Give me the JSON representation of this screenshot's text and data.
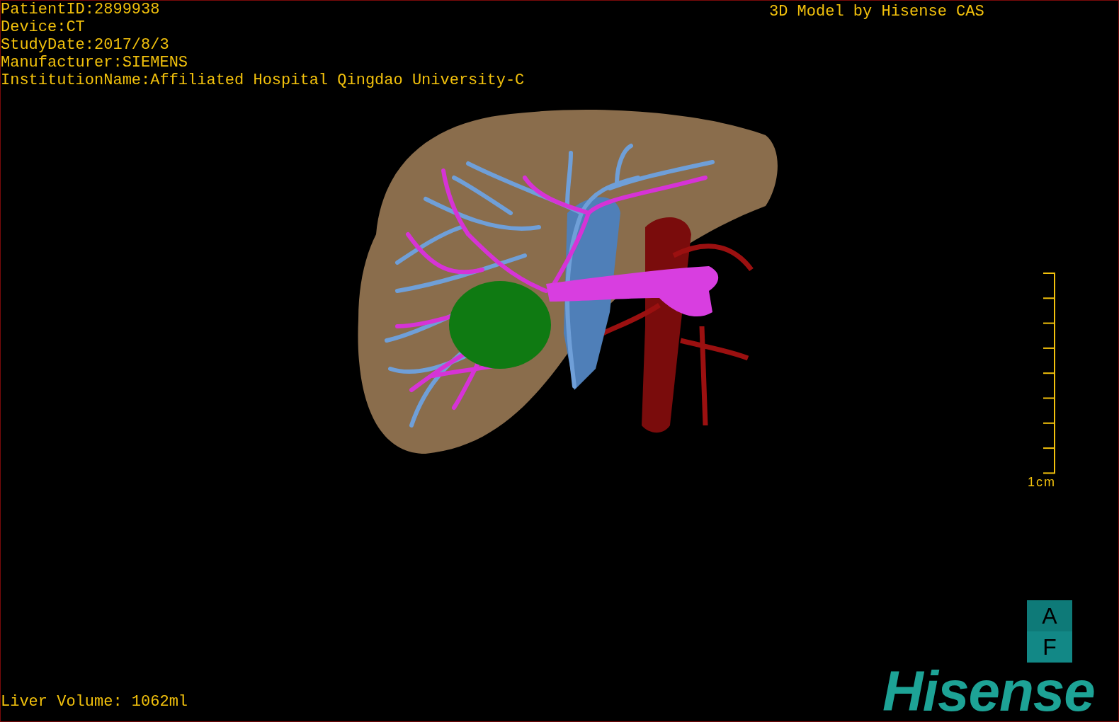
{
  "patient_info": [
    "PatientID:2899938",
    "Device:CT",
    "StudyDate:2017/8/3",
    "Manufacturer:SIEMENS",
    "InstitutionName:Affiliated Hospital Qingdao University-C"
  ],
  "model_credit": "3D Model by Hisense CAS",
  "scale_bar": {
    "label": "1cm"
  },
  "orientation_marker": [
    "A",
    "F"
  ],
  "logo": "Hisense",
  "liver_volume": "Liver Volume: 1062ml"
}
